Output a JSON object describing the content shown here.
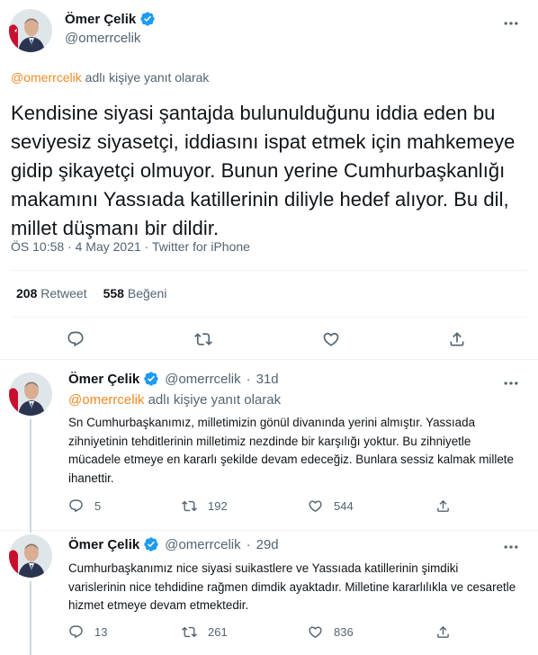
{
  "main_tweet": {
    "author_name": "Ömer Çelik",
    "handle": "@omerrcelik",
    "reply_mention": "@omerrcelik",
    "reply_suffix": "adlı kişiye yanıt olarak",
    "text": "Kendisine siyasi şantajda bulunulduğunu iddia eden bu seviyesiz siyasetçi, iddiasını ispat etmek için mahkemeye gidip şikayetçi olmuyor. Bunun yerine Cumhurbaşkanlığı makamını Yassıada katillerinin diliyle hedef alıyor. Bu dil, millet düşmanı bir dildir.",
    "time": "ÖS 10:58",
    "date": "4 May 2021",
    "source": "Twitter for iPhone",
    "retweet_count": "208",
    "retweet_label": "Retweet",
    "like_count": "558",
    "like_label": "Beğeni"
  },
  "replies": [
    {
      "author_name": "Ömer Çelik",
      "handle": "@omerrcelik",
      "age": "31d",
      "reply_mention": "@omerrcelik",
      "reply_suffix": "adlı kişiye yanıt olarak",
      "text": "Sn Cumhurbaşkanımız, milletimizin gönül divanında yerini almıştır. Yassıada zihniyetinin tehditlerinin milletimiz nezdinde bir karşılığı yoktur. Bu zihniyetle mücadele etmeye en kararlı şekilde devam edeceğiz. Bunlara sessiz kalmak millete ihanettir.",
      "reply_count": "5",
      "retweet_count": "192",
      "like_count": "544"
    },
    {
      "author_name": "Ömer Çelik",
      "handle": "@omerrcelik",
      "age": "29d",
      "text": "Cumhurbaşkanımız nice siyasi suikastlere ve Yassıada katillerinin şimdiki varislerinin nice tehdidine rağmen dimdik ayaktadır. Milletine kararlılıkla ve cesaretle hizmet etmeye devam etmektedir.",
      "reply_count": "13",
      "retweet_count": "261",
      "like_count": "836"
    }
  ],
  "icons": {
    "reply": "reply-icon",
    "retweet": "retweet-icon",
    "like": "heart-icon",
    "share": "share-icon",
    "more": "more-icon",
    "verified": "verified-badge-icon"
  },
  "colors": {
    "mention": "#f08a24",
    "verified": "#1d9bf0",
    "secondary_text": "#536471"
  }
}
